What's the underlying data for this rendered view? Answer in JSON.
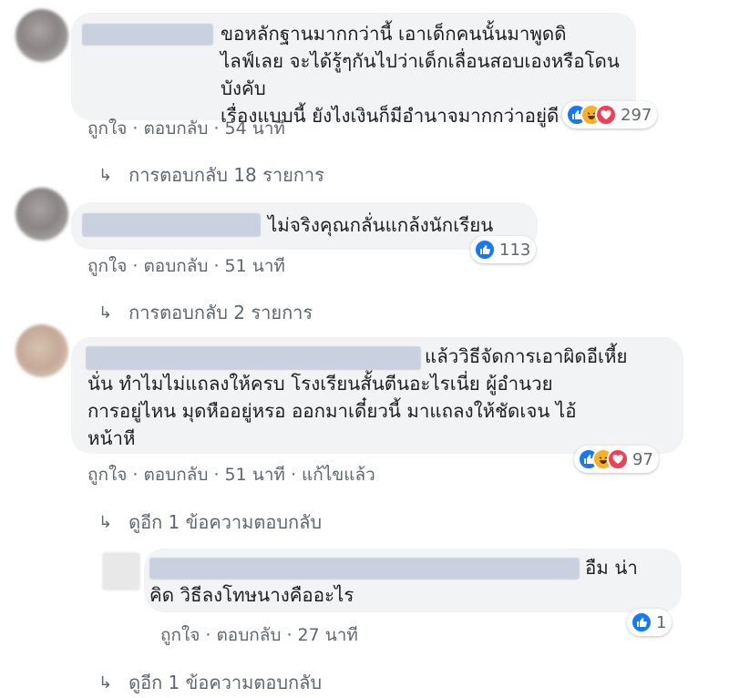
{
  "actions": {
    "like": "ถูกใจ",
    "reply": "ตอบกลับ",
    "edited": "แก้ไขแล้ว"
  },
  "comments": [
    {
      "text": "ขอหลักฐานมากกว่านี้ เอาเด็กคนนั้นมาพูดดิ\nไลฟ์เลย จะได้รู้ๆกันไปว่าเด็กเลื่อนสอบเองหรือโดนบังคับ\nเรื่องแบบนี้ ยังไงเงินก็มีอำนาจมากกว่าอยู่ดี",
      "time": "54 นาที",
      "reaction_count": "297",
      "reactions": [
        "like-icon",
        "haha-icon",
        "love-icon"
      ],
      "replies_link": "การตอบกลับ 18 รายการ"
    },
    {
      "text": "ไม่จริงคุณกลั่นแกล้งนักเรียน",
      "time": "51 นาที",
      "reaction_count": "113",
      "reactions": [
        "like-icon"
      ],
      "replies_link": "การตอบกลับ 2 รายการ"
    },
    {
      "text": "แล้ววิธีจัดการเอาผิดอีเหี้ย\nนั่น ทำไมไม่แถลงให้ครบ โรงเรียนสั้นตีนอะไรเนี่ย ผู้อำนวย\nการอยู่ไหน มุดหืออยู่หรอ ออกมาเดี๋ยวนี้ มาแถลงให้ชัดเจน ไอ้\nหน้าหี",
      "time": "51 นาที",
      "edited": true,
      "reaction_count": "97",
      "reactions": [
        "like-icon",
        "haha-icon",
        "love-icon"
      ],
      "replies_link": "ดูอีก 1 ข้อความตอบกลับ"
    }
  ],
  "nested_reply": {
    "text": "อืม น่า\nคิด วิธีลงโทษนางคืออะไร",
    "time": "27 นาที",
    "reaction_count": "1",
    "reactions": [
      "like-icon"
    ],
    "replies_link": "ดูอีก 1 ข้อความตอบกลับ"
  },
  "colors": {
    "bubble": "#f2f3f5",
    "meta_text": "#606770",
    "like": "#1877f2",
    "haha": "#f7b125",
    "love": "#f33e58"
  }
}
